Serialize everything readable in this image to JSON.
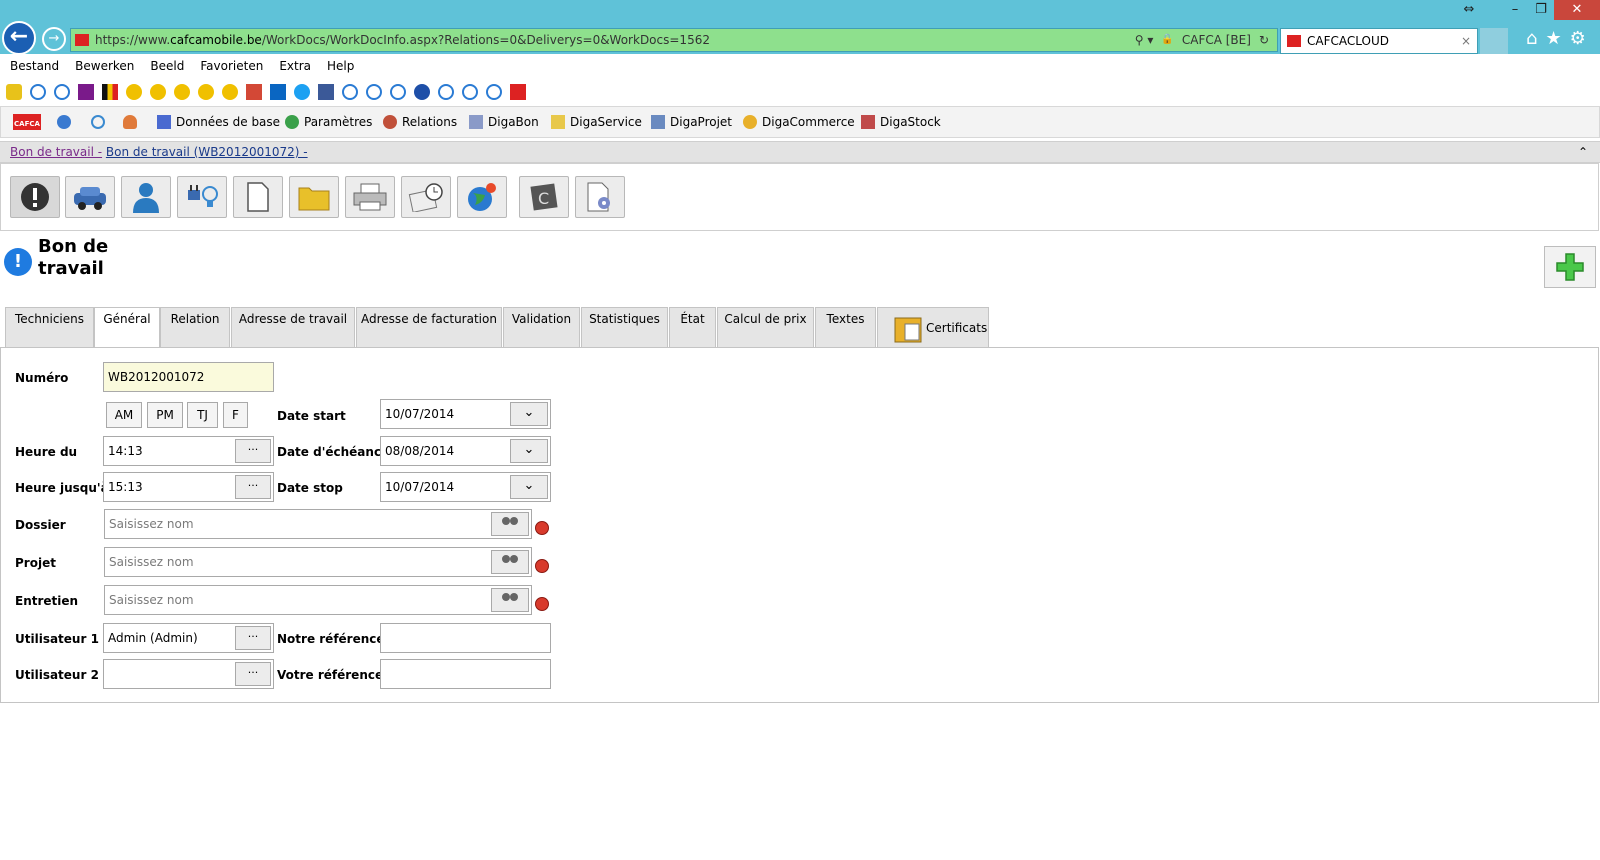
{
  "browser": {
    "address_url_prefix": "https://www.",
    "address_url_domain": "cafcamobile.be",
    "address_url_path": "/WorkDocs/WorkDocInfo.aspx?Relations=0&Deliverys=0&WorkDocs=1562",
    "security_label": "CAFCA [BE]",
    "tab_title": "CAFCACLOUD",
    "tab_close": "×",
    "back_glyph": "←",
    "forward_glyph": "→",
    "search_glyph": "⚲ ▾",
    "lock_glyph": "🔒",
    "refresh_glyph": "↻",
    "home_glyph": "⌂",
    "star_glyph": "★",
    "gear_glyph": "⚙",
    "restore_glyph": "⇔",
    "min_glyph": "–",
    "max_glyph": "❐",
    "close_glyph": "✕"
  },
  "menu": [
    "Bestand",
    "Bewerken",
    "Beeld",
    "Favorieten",
    "Extra",
    "Help"
  ],
  "app_nav": {
    "logo": "CAFCA",
    "items": [
      "Données de base",
      "Paramètres",
      "Relations",
      "DigaBon",
      "DigaService",
      "DigaProjet",
      "DigaCommerce",
      "DigaStock"
    ]
  },
  "breadcrumb": {
    "part1": "Bon de travail -",
    "part2": "Bon de travail (WB2012001072) -",
    "collapse": "⌃"
  },
  "page": {
    "title": "Bon de travail",
    "info_glyph": "!"
  },
  "tabs": [
    "Techniciens",
    "Général",
    "Relation",
    "Adresse de travail",
    "Adresse de facturation",
    "Validation",
    "Statistiques",
    "État",
    "Calcul de prix",
    "Textes",
    "Certificats"
  ],
  "active_tab": "Général",
  "form": {
    "numero_label": "Numéro",
    "numero_value": "WB2012001072",
    "shift_buttons": [
      "AM",
      "PM",
      "TJ",
      "F"
    ],
    "heure_du_label": "Heure du",
    "heure_du_value": "14:13",
    "heure_jusqua_label": "Heure jusqu'à",
    "heure_jusqua_value": "15:13",
    "date_start_label": "Date start",
    "date_start_value": "10/07/2014",
    "date_echeance_label": "Date d'échéance",
    "date_echeance_value": "08/08/2014",
    "date_stop_label": "Date stop",
    "date_stop_value": "10/07/2014",
    "dossier_label": "Dossier",
    "projet_label": "Projet",
    "entretien_label": "Entretien",
    "search_placeholder": "Saisissez nom",
    "utilisateur1_label": "Utilisateur 1",
    "utilisateur1_value": "Admin (Admin)",
    "utilisateur2_label": "Utilisateur 2",
    "utilisateur2_value": "",
    "notre_ref_label": "Notre référence",
    "notre_ref_value": "",
    "votre_ref_label": "Votre référence",
    "votre_ref_value": "",
    "ellipsis": "···",
    "chevron": "⌄"
  }
}
